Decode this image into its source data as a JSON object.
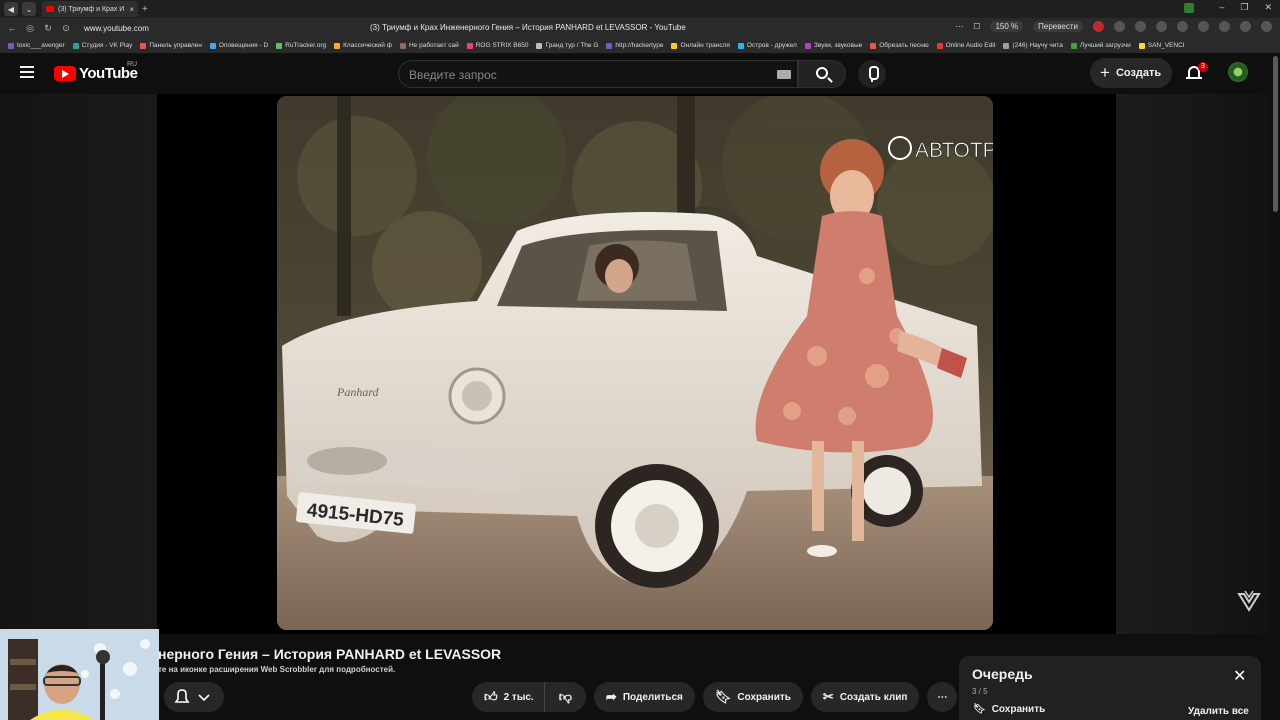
{
  "browser": {
    "tab_title": "(3) Триумф и Крах И",
    "url": "www.youtube.com",
    "page_title": "(3) Триумф и Крах Инженерного Гения – История PANHARD et LEVASSOR - YouTube",
    "zoom": "150 %",
    "translate": "Перевести",
    "bookmarks": [
      "toxic___avenger",
      "Студия - VK Play",
      "Панель управлен",
      "Оповещения - D",
      "RuTracker.org",
      "Классический ф",
      "Не работает сай",
      "ROG STRIX B650",
      "Гранд тур / The G",
      "http://hackertype",
      "Онлайн трансля",
      "Остров - дружел",
      "Звуки, звуковые",
      "Обрезать песню",
      "Online Audio Edit",
      "(246) Научу чита",
      "Лучший загрузчи",
      "SAN_VENCI"
    ]
  },
  "header": {
    "logo_text": "YouTube",
    "country_code": "RU",
    "search_placeholder": "Введите запрос",
    "create_label": "Создать",
    "notification_count": "3"
  },
  "player": {
    "watermark": "АВТОТРЕНДЫ",
    "plate": "4915-HD75",
    "car_script": "Panhard"
  },
  "video": {
    "title": "нерного Гения – История PANHARD et LEVASSOR",
    "scrobbler_note": "те на иконке расширения Web Scrobbler для подробностей.",
    "likes": "2 тыс.",
    "share": "Поделиться",
    "save": "Сохранить",
    "clip": "Создать клип"
  },
  "queue": {
    "title": "Очередь",
    "count": "3 / 5",
    "save": "Сохранить",
    "remove_all": "Удалить все"
  }
}
